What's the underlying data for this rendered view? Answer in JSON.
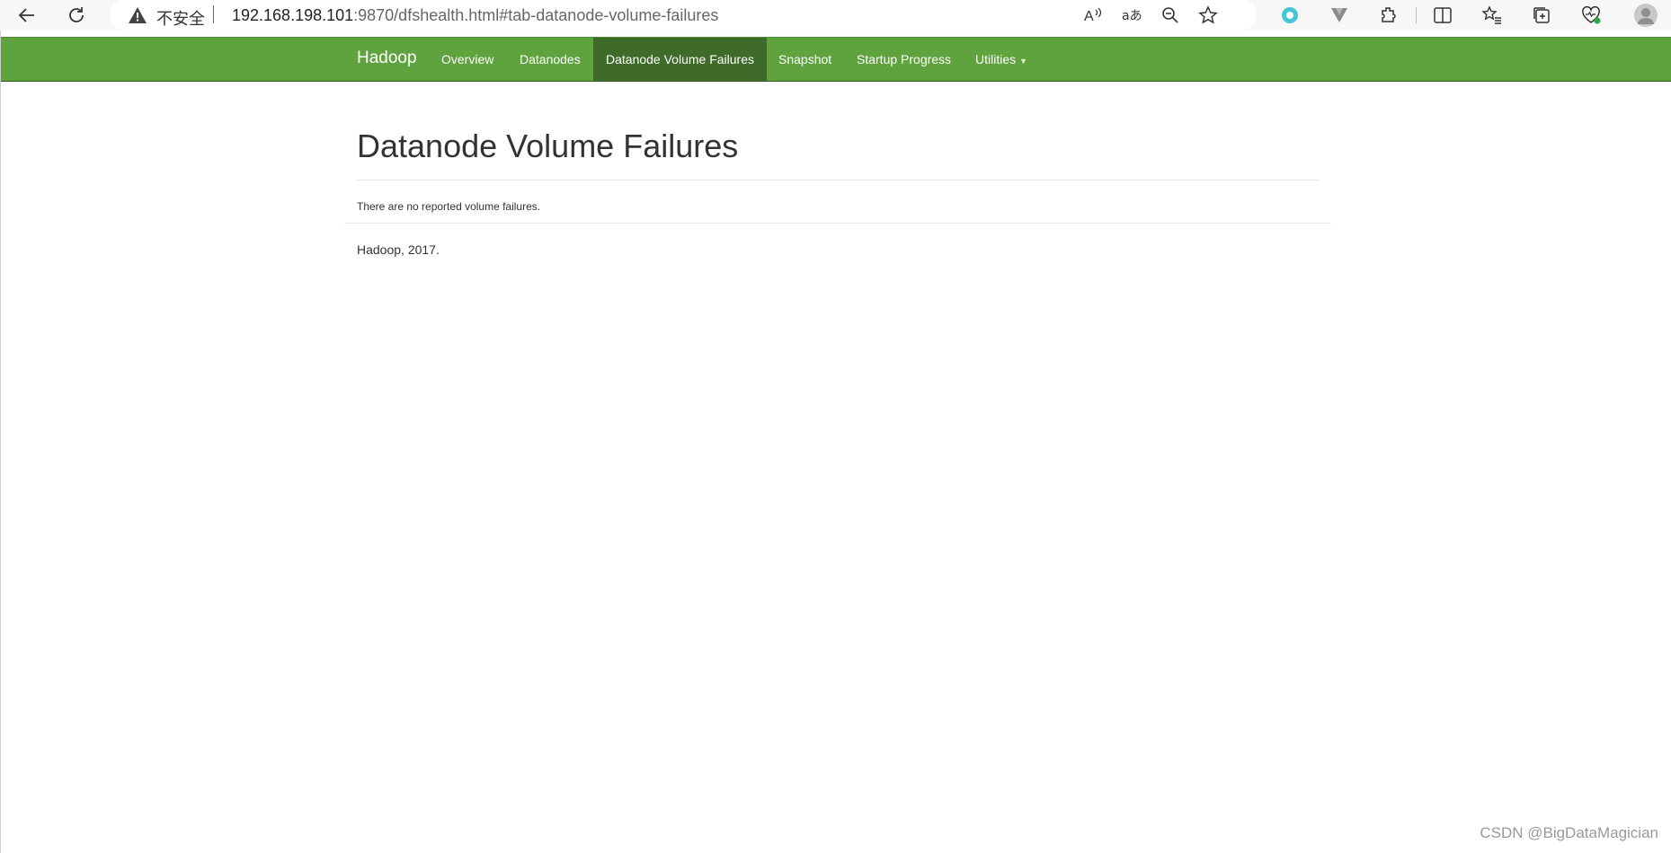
{
  "browser": {
    "security_label": "不安全",
    "url_host": "192.168.198.101",
    "url_rest": ":9870/dfshealth.html#tab-datanode-volume-failures",
    "toolbar_icons": [
      "back-icon",
      "refresh-icon",
      "warning-icon",
      "read-aloud-icon",
      "translate-icon",
      "zoom-out-icon",
      "favorite-star-icon",
      "extension-copilot-icon",
      "extension-v-icon",
      "extensions-icon",
      "split-screen-icon",
      "favorites-icon",
      "collections-icon",
      "browser-essentials-icon",
      "profile-avatar-icon"
    ]
  },
  "navbar": {
    "brand": "Hadoop",
    "items": [
      {
        "label": "Overview"
      },
      {
        "label": "Datanodes"
      },
      {
        "label": "Datanode Volume Failures",
        "active": true
      },
      {
        "label": "Snapshot"
      },
      {
        "label": "Startup Progress"
      },
      {
        "label": "Utilities",
        "dropdown": true
      }
    ],
    "colors": {
      "bar": "#5fa33e",
      "active": "#3e6b2a"
    }
  },
  "main": {
    "title": "Datanode Volume Failures",
    "message": "There are no reported volume failures."
  },
  "footer": {
    "text": "Hadoop, 2017."
  },
  "watermark": "CSDN @BigDataMagician"
}
